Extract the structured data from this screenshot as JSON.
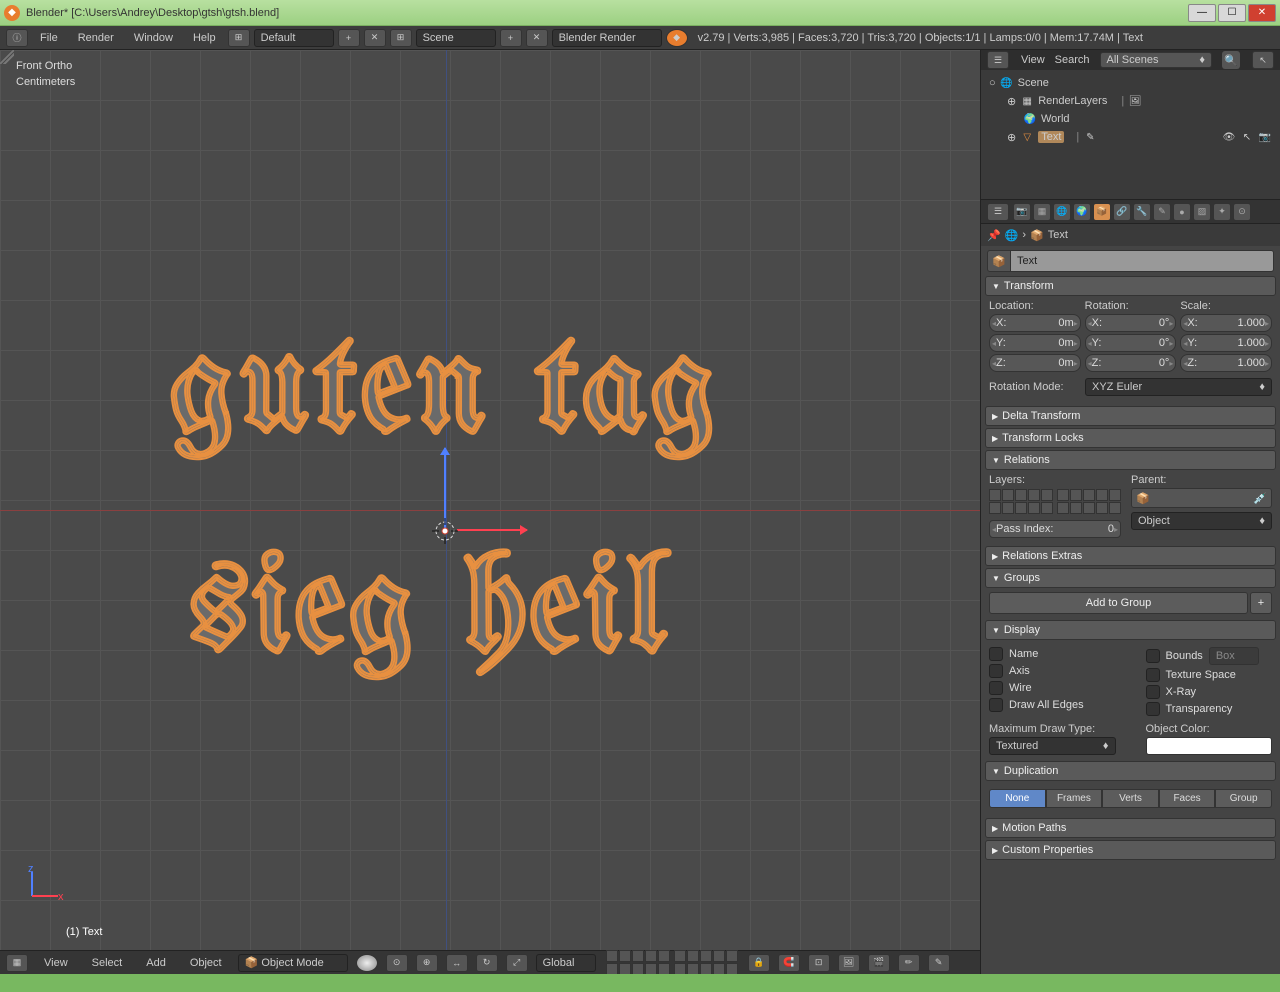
{
  "app": {
    "title": "Blender* [C:\\Users\\Andrey\\Desktop\\gtsh\\gtsh.blend]"
  },
  "menubar": {
    "items": [
      "File",
      "Render",
      "Window",
      "Help"
    ],
    "layout": "Default",
    "scene": "Scene",
    "engine": "Blender Render",
    "stats": "v2.79 | Verts:3,985 | Faces:3,720 | Tris:3,720 | Objects:1/1 | Lamps:0/0 | Mem:17.74M | Text"
  },
  "viewport": {
    "view_label": "Front Ortho",
    "units_label": "Centimeters",
    "object_label": "(1) Text",
    "text_line1": "guten tag",
    "text_line2": "sieg heil"
  },
  "viewport_header": {
    "view": "View",
    "select": "Select",
    "add": "Add",
    "object": "Object",
    "mode": "Object Mode",
    "orientation": "Global"
  },
  "outliner": {
    "view": "View",
    "search": "Search",
    "all_scenes": "All Scenes",
    "tree": {
      "root": "Scene",
      "renderlayers": "RenderLayers",
      "world": "World",
      "text": "Text"
    }
  },
  "properties": {
    "breadcrumb_obj": "Text",
    "name": "Text",
    "sections": {
      "transform": "Transform",
      "location": "Location:",
      "rotation": "Rotation:",
      "scale": "Scale:",
      "loc": {
        "x": "X:",
        "xv": "0m",
        "y": "Y:",
        "yv": "0m",
        "z": "Z:",
        "zv": "0m"
      },
      "rot": {
        "x": "X:",
        "xv": "0°",
        "y": "Y:",
        "yv": "0°",
        "z": "Z:",
        "zv": "0°"
      },
      "scl": {
        "x": "X:",
        "xv": "1.000",
        "y": "Y:",
        "yv": "1.000",
        "z": "Z:",
        "zv": "1.000"
      },
      "rotmode_lbl": "Rotation Mode:",
      "rotmode": "XYZ Euler",
      "delta": "Delta Transform",
      "locks": "Transform Locks",
      "relations": "Relations",
      "layers": "Layers:",
      "parent": "Parent:",
      "passindex": "Pass Index:",
      "passindex_val": "0",
      "parent_type": "Object",
      "relextras": "Relations Extras",
      "groups": "Groups",
      "addgroup": "Add to Group",
      "display": "Display",
      "chk": {
        "name": "Name",
        "axis": "Axis",
        "wire": "Wire",
        "drawedges": "Draw All Edges",
        "bounds": "Bounds",
        "box": "Box",
        "texspace": "Texture Space",
        "xray": "X-Ray",
        "transp": "Transparency"
      },
      "maxdraw_lbl": "Maximum Draw Type:",
      "maxdraw": "Textured",
      "objcolor": "Object Color:",
      "duplication": "Duplication",
      "dup": {
        "none": "None",
        "frames": "Frames",
        "verts": "Verts",
        "faces": "Faces",
        "group": "Group"
      },
      "motionpaths": "Motion Paths",
      "customprops": "Custom Properties"
    }
  }
}
